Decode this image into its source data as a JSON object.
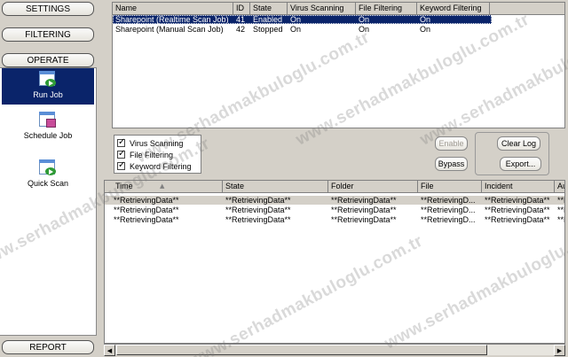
{
  "nav": {
    "settings": "SETTINGS",
    "filtering": "FILTERING",
    "operate": "OPERATE",
    "report": "REPORT",
    "items": [
      {
        "label": "Run Job",
        "icon": "run-job-icon"
      },
      {
        "label": "Schedule Job",
        "icon": "schedule-job-icon"
      },
      {
        "label": "Quick Scan",
        "icon": "quick-scan-icon"
      }
    ]
  },
  "jobs": {
    "columns": [
      "Name",
      "ID",
      "State",
      "Virus Scanning",
      "File Filtering",
      "Keyword Filtering"
    ],
    "rows": [
      {
        "name": "Sharepoint (Realtime Scan Job)",
        "id": "41",
        "state": "Enabled",
        "virus": "On",
        "file": "On",
        "keyword": "On"
      },
      {
        "name": "Sharepoint (Manual Scan Job)",
        "id": "42",
        "state": "Stopped",
        "virus": "On",
        "file": "On",
        "keyword": "On"
      }
    ]
  },
  "filters": {
    "virus": "Virus Scanning",
    "file": "File Filtering",
    "keyword": "Keyword Filtering"
  },
  "buttons": {
    "enable": "Enable",
    "bypass": "Bypass",
    "clear_log": "Clear Log",
    "export": "Export..."
  },
  "log": {
    "columns": [
      "Time",
      "State",
      "Folder",
      "File",
      "Incident",
      "Au"
    ],
    "sort_icon": "sort-ascending-icon",
    "rows": [
      {
        "time": "**RetrievingData**",
        "state": "**RetrievingData**",
        "folder": "**RetrievingData**",
        "file": "**RetrievingD...",
        "incident": "**RetrievingData**",
        "au": "**F"
      },
      {
        "time": "**RetrievingData**",
        "state": "**RetrievingData**",
        "folder": "**RetrievingData**",
        "file": "**RetrievingD...",
        "incident": "**RetrievingData**",
        "au": "**F"
      },
      {
        "time": "**RetrievingData**",
        "state": "**RetrievingData**",
        "folder": "**RetrievingData**",
        "file": "**RetrievingD...",
        "incident": "**RetrievingData**",
        "au": "**F"
      }
    ]
  },
  "watermark": "www.serhadmakbuloglu.com.tr",
  "colors": {
    "selection": "#0a246a",
    "face": "#d4d0c8"
  }
}
